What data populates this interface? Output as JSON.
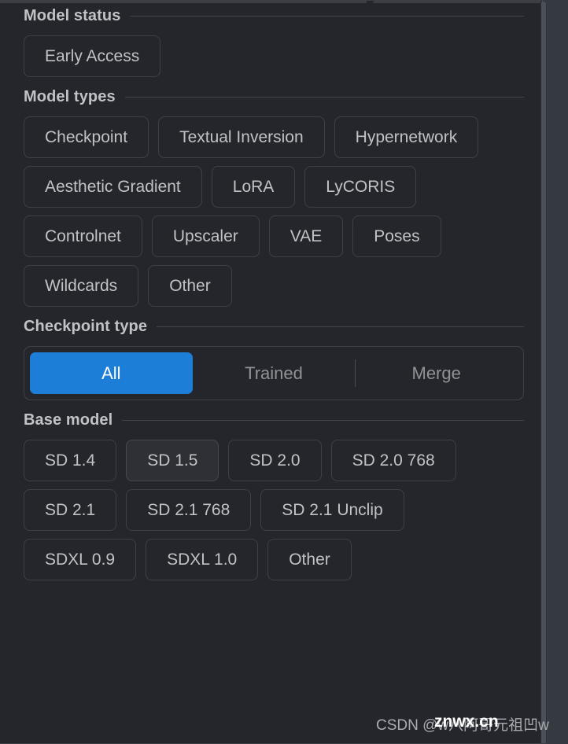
{
  "panel": {
    "name": "model-filters-drawer"
  },
  "colors": {
    "accent": "#1c7ed6",
    "panel_background": "#25262b",
    "page_background": "#343a40",
    "chip_border": "#3d4147",
    "chip_hover_background": "#2e3035",
    "text_primary": "#c1c2c5",
    "text_muted": "#909296",
    "divider": "#40444b",
    "scrollbar_thumb": "#495057"
  },
  "sections": [
    {
      "id": "model-status",
      "title": "Model status",
      "kind": "chips",
      "chips": [
        {
          "label": "Early Access",
          "state": "default"
        }
      ]
    },
    {
      "id": "model-types",
      "title": "Model types",
      "kind": "chips",
      "chips": [
        {
          "label": "Checkpoint",
          "state": "default"
        },
        {
          "label": "Textual Inversion",
          "state": "default"
        },
        {
          "label": "Hypernetwork",
          "state": "default"
        },
        {
          "label": "Aesthetic Gradient",
          "state": "default"
        },
        {
          "label": "LoRA",
          "state": "default"
        },
        {
          "label": "LyCORIS",
          "state": "default"
        },
        {
          "label": "Controlnet",
          "state": "default"
        },
        {
          "label": "Upscaler",
          "state": "default"
        },
        {
          "label": "VAE",
          "state": "default"
        },
        {
          "label": "Poses",
          "state": "default"
        },
        {
          "label": "Wildcards",
          "state": "default"
        },
        {
          "label": "Other",
          "state": "default"
        }
      ]
    },
    {
      "id": "checkpoint-type",
      "title": "Checkpoint type",
      "kind": "segmented",
      "selected": "All",
      "options": [
        {
          "label": "All",
          "selected": true,
          "divider_before": false
        },
        {
          "label": "Trained",
          "selected": false,
          "divider_before": false
        },
        {
          "label": "Merge",
          "selected": false,
          "divider_before": true
        }
      ]
    },
    {
      "id": "base-model",
      "title": "Base model",
      "kind": "chips",
      "chips": [
        {
          "label": "SD 1.4",
          "state": "default"
        },
        {
          "label": "SD 1.5",
          "state": "hovered"
        },
        {
          "label": "SD 2.0",
          "state": "default"
        },
        {
          "label": "SD 2.0 768",
          "state": "default"
        },
        {
          "label": "SD 2.1",
          "state": "default"
        },
        {
          "label": "SD 2.1 768",
          "state": "default"
        },
        {
          "label": "SD 2.1 Unclip",
          "state": "default"
        },
        {
          "label": "SDXL 0.9",
          "state": "default"
        },
        {
          "label": "SDXL 1.0",
          "state": "default"
        },
        {
          "label": "Other",
          "state": "default"
        }
      ]
    }
  ],
  "watermark": {
    "csdn_text": "CSDN @w八阿哥元祖凹w",
    "overlay_text": "znwx.cn"
  }
}
